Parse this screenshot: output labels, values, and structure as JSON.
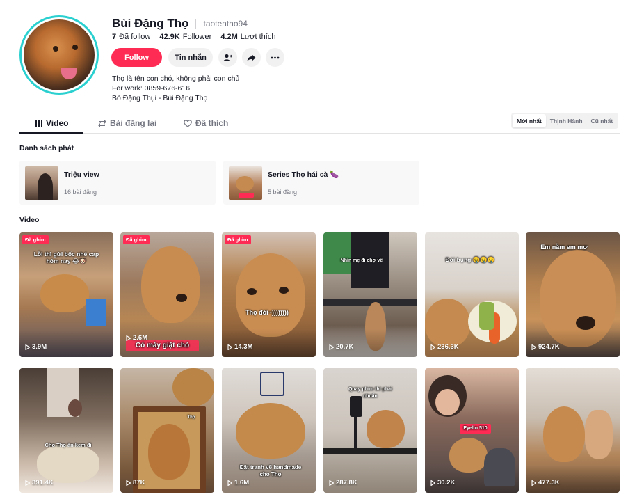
{
  "profile": {
    "display_name": "Bùi Đặng Thọ",
    "username": "taotentho94",
    "stats": [
      {
        "value": "7",
        "label": "Đã follow"
      },
      {
        "value": "42.9K",
        "label": "Follower"
      },
      {
        "value": "4.2M",
        "label": "Lượt thích"
      }
    ],
    "follow_label": "Follow",
    "message_label": "Tin nhắn",
    "bio_lines": [
      "Thọ là tên con chó, không phải con chủ",
      "For work: 0859-676-616",
      "Bò Đặng Thụi - Bùi Đặng Thọ"
    ],
    "avatar_ring_color": "#2ad0cf"
  },
  "tabs": [
    {
      "label": "Video",
      "icon": "grid-icon",
      "active": true
    },
    {
      "label": "Bài đăng lại",
      "icon": "repost-icon",
      "active": false
    },
    {
      "label": "Đã thích",
      "icon": "heart-outline-icon",
      "active": false
    }
  ],
  "sort": [
    {
      "label": "Mới nhất",
      "active": true
    },
    {
      "label": "Thịnh Hành",
      "active": false
    },
    {
      "label": "Cũ nhất",
      "active": false
    }
  ],
  "playlists_title": "Danh sách phát",
  "playlists": [
    {
      "title": "Triệu view",
      "count": "16 bài đăng"
    },
    {
      "title": "Series Thọ hái cà 🍆",
      "count": "5 bài đăng"
    }
  ],
  "videos_title": "Video",
  "videos": [
    {
      "views": "3.9M",
      "pinned": true,
      "caption": "Lỗi thì gửi bốc nhé cap hôm nay 😂🐶"
    },
    {
      "views": "2.6M",
      "pinned": true,
      "caption": "Có máy giặt chó"
    },
    {
      "views": "14.3M",
      "pinned": true,
      "caption": "Thọ đói~))))))))"
    },
    {
      "views": "20.7K",
      "pinned": false,
      "caption": "Nhìn mẹ đi chợ về"
    },
    {
      "views": "236.3K",
      "pinned": false,
      "caption": "Đói bụng 🤤🤤🤤"
    },
    {
      "views": "924.7K",
      "pinned": false,
      "caption": "Em nằm em mơ"
    },
    {
      "views": "391.4K",
      "pinned": false,
      "caption": "Cho Thọ ăn kem đi"
    },
    {
      "views": "87K",
      "pinned": false,
      "caption": "Thọ"
    },
    {
      "views": "1.6M",
      "pinned": false,
      "caption": "Đặt tranh vẽ handmade cho Thọ"
    },
    {
      "views": "287.8K",
      "pinned": false,
      "caption": "Quay phim thì phải chuẩn"
    },
    {
      "views": "30.2K",
      "pinned": false,
      "caption": "Eyelin 510"
    },
    {
      "views": "477.3K",
      "pinned": false,
      "caption": ""
    }
  ],
  "pinned_label": "Đã ghim",
  "colors": {
    "accent": "#fe2c55",
    "text": "#161823",
    "muted": "#737580"
  }
}
